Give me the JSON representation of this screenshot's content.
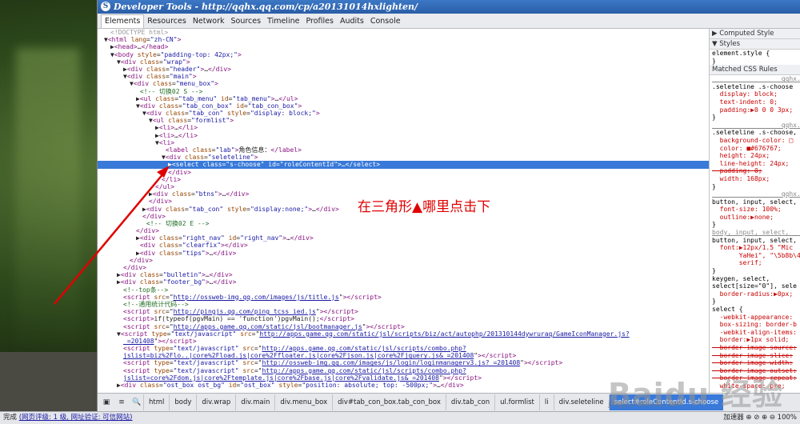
{
  "window": {
    "title": "Developer Tools - http://qqhx.qq.com/cp/a20131014hxlighten/"
  },
  "tabs": [
    "Elements",
    "Resources",
    "Network",
    "Sources",
    "Timeline",
    "Profiles",
    "Audits",
    "Console"
  ],
  "dom_lines": [
    {
      "i": 1,
      "html": "<span class='gr'>&lt;!DOCTYPE html&gt;</span>"
    },
    {
      "i": 0,
      "html": "▼<span class='tag'>&lt;html</span> <span class='an'>lang</span>=<span class='av'>\"zh-CN\"</span><span class='tag'>&gt;</span>"
    },
    {
      "i": 1,
      "html": "▶<span class='tag'>&lt;head&gt;</span>…<span class='tag'>&lt;/head&gt;</span>"
    },
    {
      "i": 1,
      "html": "▼<span class='tag'>&lt;body</span> <span class='an'>style</span>=<span class='av'>\"padding-top: 42px;\"</span><span class='tag'>&gt;</span>"
    },
    {
      "i": 2,
      "html": "▼<span class='tag'>&lt;div</span> <span class='an'>class</span>=<span class='av'>\"wrap\"</span><span class='tag'>&gt;</span>"
    },
    {
      "i": 3,
      "html": "▶<span class='tag'>&lt;div</span> <span class='an'>class</span>=<span class='av'>\"header\"</span><span class='tag'>&gt;</span>…<span class='tag'>&lt;/div&gt;</span>"
    },
    {
      "i": 3,
      "html": "▼<span class='tag'>&lt;div</span> <span class='an'>class</span>=<span class='av'>\"main\"</span><span class='tag'>&gt;</span>"
    },
    {
      "i": 4,
      "html": "▼<span class='tag'>&lt;div</span> <span class='an'>class</span>=<span class='av'>\"menu_box\"</span><span class='tag'>&gt;</span>"
    },
    {
      "i": 5,
      "html": " <span class='cm'>&lt;!-- 切换02 S --&gt;</span>"
    },
    {
      "i": 5,
      "html": "▶<span class='tag'>&lt;ul</span> <span class='an'>class</span>=<span class='av'>\"tab_menu\"</span> <span class='an'>id</span>=<span class='av'>\"tab_menu\"</span><span class='tag'>&gt;</span>…<span class='tag'>&lt;/ul&gt;</span>"
    },
    {
      "i": 5,
      "html": "▼<span class='tag'>&lt;div</span> <span class='an'>class</span>=<span class='av'>\"tab_con_box\"</span> <span class='an'>id</span>=<span class='av'>\"tab_con_box\"</span><span class='tag'>&gt;</span>"
    },
    {
      "i": 6,
      "html": "▼<span class='tag'>&lt;div</span> <span class='an'>class</span>=<span class='av'>\"tab_con\"</span> <span class='an'>style</span>=<span class='av'>\"display: block;\"</span><span class='tag'>&gt;</span>"
    },
    {
      "i": 7,
      "html": "▼<span class='tag'>&lt;ul</span> <span class='an'>class</span>=<span class='av'>\"formlist\"</span><span class='tag'>&gt;</span>"
    },
    {
      "i": 8,
      "html": "▶<span class='tag'>&lt;li&gt;</span>…<span class='tag'>&lt;/li&gt;</span>"
    },
    {
      "i": 8,
      "html": "▶<span class='tag'>&lt;li&gt;</span>…<span class='tag'>&lt;/li&gt;</span>"
    },
    {
      "i": 8,
      "html": "▼<span class='tag'>&lt;li&gt;</span>"
    },
    {
      "i": 9,
      "html": " <span class='tag'>&lt;label</span> <span class='an'>class</span>=<span class='av'>\"lab\"</span><span class='tag'>&gt;</span>角色信息：<span class='tag'>&lt;/label&gt;</span>"
    },
    {
      "i": 9,
      "html": "▼<span class='tag'>&lt;div</span> <span class='an'>class</span>=<span class='av'>\"seleteline\"</span><span class='tag'>&gt;</span>"
    },
    {
      "i": 10,
      "sel": true,
      "html": "▶<span class='tag'>&lt;select</span> <span class='an'>class</span>=<span class='av'>\"s-choose\"</span> <span class='an'>id</span>=<span class='av'>\"roleContentId\"</span><span class='tag'>&gt;</span>…<span class='tag'>&lt;/select&gt;</span>"
    },
    {
      "i": 10,
      "html": "<span class='tag'>&lt;/div&gt;</span>"
    },
    {
      "i": 9,
      "html": "<span class='tag'>&lt;/li&gt;</span>"
    },
    {
      "i": 8,
      "html": "<span class='tag'>&lt;/ul&gt;</span>"
    },
    {
      "i": 7,
      "html": "▶<span class='tag'>&lt;div</span> <span class='an'>class</span>=<span class='av'>\"btns\"</span><span class='tag'>&gt;</span>…<span class='tag'>&lt;/div&gt;</span>"
    },
    {
      "i": 7,
      "html": "<span class='tag'>&lt;/div&gt;</span>"
    },
    {
      "i": 6,
      "html": "▶<span class='tag'>&lt;div</span> <span class='an'>class</span>=<span class='av'>\"tab_con\"</span> <span class='an'>style</span>=<span class='av'>\"display:none;\"</span><span class='tag'>&gt;</span>…<span class='tag'>&lt;/div&gt;</span>"
    },
    {
      "i": 6,
      "html": "<span class='tag'>&lt;/div&gt;</span>"
    },
    {
      "i": 6,
      "html": " <span class='cm'>&lt;!-- 切换02 E --&gt;</span>"
    },
    {
      "i": 5,
      "html": "<span class='tag'>&lt;/div&gt;</span>"
    },
    {
      "i": 5,
      "html": "▶<span class='tag'>&lt;div</span> <span class='an'>class</span>=<span class='av'>\"right_nav\"</span> <span class='an'>id</span>=<span class='av'>\"right_nav\"</span><span class='tag'>&gt;</span>…<span class='tag'>&lt;/div&gt;</span>"
    },
    {
      "i": 5,
      "html": " <span class='tag'>&lt;div</span> <span class='an'>class</span>=<span class='av'>\"clearfix\"</span><span class='tag'>&gt;&lt;/div&gt;</span>"
    },
    {
      "i": 5,
      "html": "▶<span class='tag'>&lt;div</span> <span class='an'>class</span>=<span class='av'>\"tips\"</span><span class='tag'>&gt;</span>…<span class='tag'>&lt;/div&gt;</span>"
    },
    {
      "i": 4,
      "html": "<span class='tag'>&lt;/div&gt;</span>"
    },
    {
      "i": 3,
      "html": "<span class='tag'>&lt;/div&gt;</span>"
    },
    {
      "i": 2,
      "html": "▶<span class='tag'>&lt;div</span> <span class='an'>class</span>=<span class='av'>\"bulletin\"</span><span class='tag'>&gt;</span>…<span class='tag'>&lt;/div&gt;</span>"
    },
    {
      "i": 2,
      "html": "▶<span class='tag'>&lt;div</span> <span class='an'>class</span>=<span class='av'>\"footer_bg\"</span><span class='tag'>&gt;</span>…<span class='tag'>&lt;/div&gt;</span>"
    },
    {
      "i": 3,
      "html": "<span class='cm'>&lt;!--top条--&gt;</span>"
    },
    {
      "i": 3,
      "html": "<span class='tag'>&lt;script</span> <span class='an'>src</span>=\"<span class='lk'>http://ossweb-img.qq.com/images/js/title.js</span>\"<span class='tag'>&gt;&lt;/script&gt;</span>"
    },
    {
      "i": 3,
      "html": "<span class='cm'>&lt;!--通用统计代码--&gt;</span>"
    },
    {
      "i": 3,
      "html": "<span class='tag'>&lt;script</span> <span class='an'>src</span>=\"<span class='lk'>http://pingjs.qq.com/ping_tcss_ied.js</span>\"<span class='tag'>&gt;&lt;/script&gt;</span>"
    },
    {
      "i": 3,
      "html": "<span class='tag'>&lt;script&gt;</span>if(typeof(pgvMain) == 'function')pgvMain();<span class='tag'>&lt;/script&gt;</span>"
    },
    {
      "i": 3,
      "html": "<span class='tag'>&lt;script</span> <span class='an'>src</span>=\"<span class='lk'>http://apps.game.qq.com/static/jsl/bootmanager.js</span>\"<span class='tag'>&gt;&lt;/script&gt;</span>"
    },
    {
      "i": 2,
      "html": "▼<span class='tag'>&lt;script</span> <span class='an'>type</span>=<span class='av'>\"text/javascript\"</span> <span class='an'>src</span>=\"<span class='lk'>http://apps.game.qq.com/static/jsl/scripts/biz/act/autophp/201310144dywruraq/GameIconManager.js?</span>"
    },
    {
      "i": 3,
      "html": "<span class='lk'>_=201408</span>\"<span class='tag'>&gt;&lt;/script&gt;</span>"
    },
    {
      "i": 3,
      "html": "<span class='tag'>&lt;script</span> <span class='an'>type</span>=<span class='av'>\"text/javascript\"</span> <span class='an'>src</span>=\"<span class='lk'>http://apps.game.qq.com/static/jsl/scripts/combo.php?</span>"
    },
    {
      "i": 3,
      "html": "<span class='lk'>jslist=biz%2Flo..|core%2Fload.js|core%2Ffloater.js|core%2Fjson.js|core%2Fjquery.js&amp;_=201408</span>\"<span class='tag'>&gt;&lt;/script&gt;</span>"
    },
    {
      "i": 3,
      "html": "<span class='tag'>&lt;script</span> <span class='an'>type</span>=<span class='av'>\"text/javascript\"</span> <span class='an'>src</span>=\"<span class='lk'>http://ossweb-img.qq.com/images/js/login/loginmanagerv3.js?_=201408</span>\"<span class='tag'>&gt;&lt;/script&gt;</span>"
    },
    {
      "i": 3,
      "html": "<span class='tag'>&lt;script</span> <span class='an'>type</span>=<span class='av'>\"text/javascript\"</span> <span class='an'>src</span>=\"<span class='lk'>http://apps.game.qq.com/static/jsl/scripts/combo.php?</span>"
    },
    {
      "i": 3,
      "html": "<span class='lk'>jslist=core%2Fdom.js|core%2Ftemplate.js|core%2Fbase.js|core%2Fvalidate.js&amp;_=201408</span>\"<span class='tag'>&gt;&lt;/script&gt;</span>"
    },
    {
      "i": 2,
      "html": "▶<span class='tag'>&lt;div</span> <span class='an'>class</span>=<span class='av'>\"ost_box ost_bg\"</span> <span class='an'>id</span>=<span class='av'>\"ost_box\"</span> <span class='an'>style</span>=<span class='av'>\"position: absolute; top: -500px;\"</span><span class='tag'>&gt;</span>…<span class='tag'>&lt;/div&gt;</span>"
    }
  ],
  "styles_pane": [
    {
      "cls": "hdr",
      "text": "▶ Computed Style"
    },
    {
      "cls": "hdr",
      "text": "▼ Styles"
    },
    {
      "text": "element.style {"
    },
    {
      "text": "}"
    },
    {
      "cls": "hdr",
      "text": "Matched CSS Rules"
    },
    {
      "src": true,
      "text": "                  qqhx.qq.com/cp/a2"
    },
    {
      "text": ".seleteline .s-choose"
    },
    {
      "prop": true,
      "text": "  display: block;"
    },
    {
      "prop": true,
      "text": "  text-indent: 0;"
    },
    {
      "prop": true,
      "text": "  padding:▶0 0 0 3px;"
    },
    {
      "text": "}"
    },
    {
      "src": true,
      "text": "                  qqhx.qq.com/cp/a2"
    },
    {
      "text": ".seleteline .s-choose,"
    },
    {
      "prop": true,
      "text": "  background-color: □"
    },
    {
      "prop": true,
      "text": "  color: ■#676767;"
    },
    {
      "prop": true,
      "text": "  height: 24px;"
    },
    {
      "prop": true,
      "text": "  line-height: 24px;"
    },
    {
      "prop": true,
      "strike": true,
      "text": "  padding: 0;"
    },
    {
      "prop": true,
      "text": "  width: 168px;"
    },
    {
      "text": "}"
    },
    {
      "src": true,
      "text": "                  qqhx.qq.com/cp/a2"
    },
    {
      "text": "button, input, select,"
    },
    {
      "prop": true,
      "text": "  font-size: 100%;"
    },
    {
      "prop": true,
      "text": "  outline:▶none;"
    },
    {
      "text": "}"
    },
    {
      "src": true,
      "text": "body, input, select,    qqhx.qq.com"
    },
    {
      "text": "button, input, select,"
    },
    {
      "prop": true,
      "text": "  font:▶12px/1.5 \"Mic"
    },
    {
      "prop": true,
      "text": "       YaHei\", \"\\5b8b\\4f5"
    },
    {
      "prop": true,
      "text": "       serif;"
    },
    {
      "text": "}"
    },
    {
      "text": "keygen, select,        u"
    },
    {
      "text": "select[size=\"0\"], sele"
    },
    {
      "prop": true,
      "text": "  border-radius:▶0px;"
    },
    {
      "text": "}"
    },
    {
      "text": "select {               u"
    },
    {
      "prop": true,
      "text": "  -webkit-appearance:"
    },
    {
      "prop": true,
      "text": "  box-sizing: border-b"
    },
    {
      "prop": true,
      "text": "  -webkit-align-items:"
    },
    {
      "prop": true,
      "text": "  border:▶1px solid;"
    },
    {
      "prop": true,
      "strike": true,
      "text": "  border-image-source:"
    },
    {
      "prop": true,
      "strike": true,
      "text": "  border-image-slice:"
    },
    {
      "prop": true,
      "strike": true,
      "text": "  border-image-width:"
    },
    {
      "prop": true,
      "strike": true,
      "text": "  border-image-outset:"
    },
    {
      "prop": true,
      "strike": true,
      "text": "  border-image-repeat:"
    },
    {
      "prop": true,
      "text": "  white-space: pre;"
    }
  ],
  "breadcrumbs": [
    "html",
    "body",
    "div.wrap",
    "div.main",
    "div.menu_box",
    "div#tab_con_box.tab_con_box",
    "div.tab_con",
    "ul.formlist",
    "li",
    "div.seleteline",
    "select#roleContentId.s-choose"
  ],
  "bottom_buttons": [
    "▣",
    "≡",
    "🔍"
  ],
  "status": {
    "left": "完成",
    "links": "(网页评级: 1 级, 网址验证: 可信网站)",
    "right": "加速器  ⊕ ⊘ ⊕ ⊖ 100%"
  },
  "annotation": "在三角形▲哪里点击下",
  "watermark": "Baidu 经验",
  "watermark_url": "jingyan.baidu.com"
}
